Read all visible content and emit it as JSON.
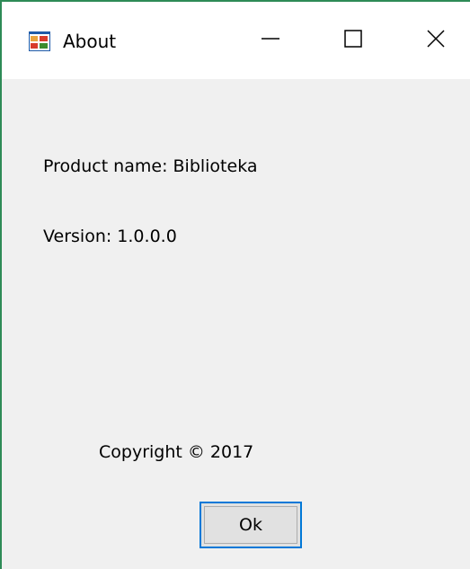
{
  "window": {
    "title": "About",
    "app_icon": "windows-form-icon",
    "controls": {
      "minimize_icon": "minimize-icon",
      "maximize_icon": "maximize-icon",
      "close_icon": "close-icon"
    }
  },
  "content": {
    "product_name": "Product name: Biblioteka",
    "version": "Version: 1.0.0.0",
    "copyright": "Copyright © 2017"
  },
  "buttons": {
    "ok_label": "Ok"
  },
  "colors": {
    "accent": "#0078d7",
    "window_border": "#2e8b57",
    "background": "#f0f0f0",
    "titlebar": "#ffffff"
  }
}
